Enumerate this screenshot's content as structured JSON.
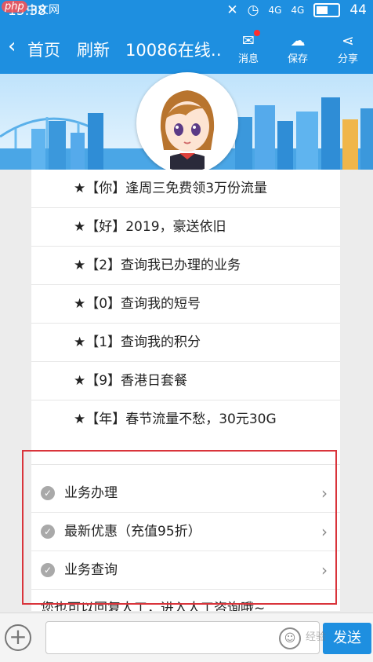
{
  "status_bar": {
    "time": "15:38",
    "watermark_logo": "php",
    "watermark_text": "中文网",
    "signal_1": "4G",
    "signal_2": "4G",
    "battery": "44"
  },
  "nav": {
    "back_icon": "chevron-left-icon",
    "home_label": "首页",
    "refresh_label": "刷新",
    "title": "10086在线…",
    "actions": [
      {
        "label": "消息",
        "icon": "mail-icon"
      },
      {
        "label": "保存",
        "icon": "cloud-save-icon"
      },
      {
        "label": "分享",
        "icon": "share-icon"
      }
    ]
  },
  "messages": [
    "★【你】逢周三免费领3万份流量",
    "★【好】2019，豪送依旧",
    "★【2】查询我已办理的业务",
    "★【0】查询我的短号",
    "★【1】查询我的积分",
    "★【9】香港日套餐",
    "★【年】春节流量不愁，30元30G"
  ],
  "options": [
    {
      "label": "业务办理"
    },
    {
      "label": "最新优惠（充值95折）"
    },
    {
      "label": "业务查询"
    }
  ],
  "hint": "您也可以回复人工，进入人工咨询哦~",
  "input": {
    "placeholder": "",
    "send_label": "发送"
  },
  "watermark": "经验",
  "colors": {
    "brand": "#1e8fe0",
    "highlight": "#d9343b"
  }
}
